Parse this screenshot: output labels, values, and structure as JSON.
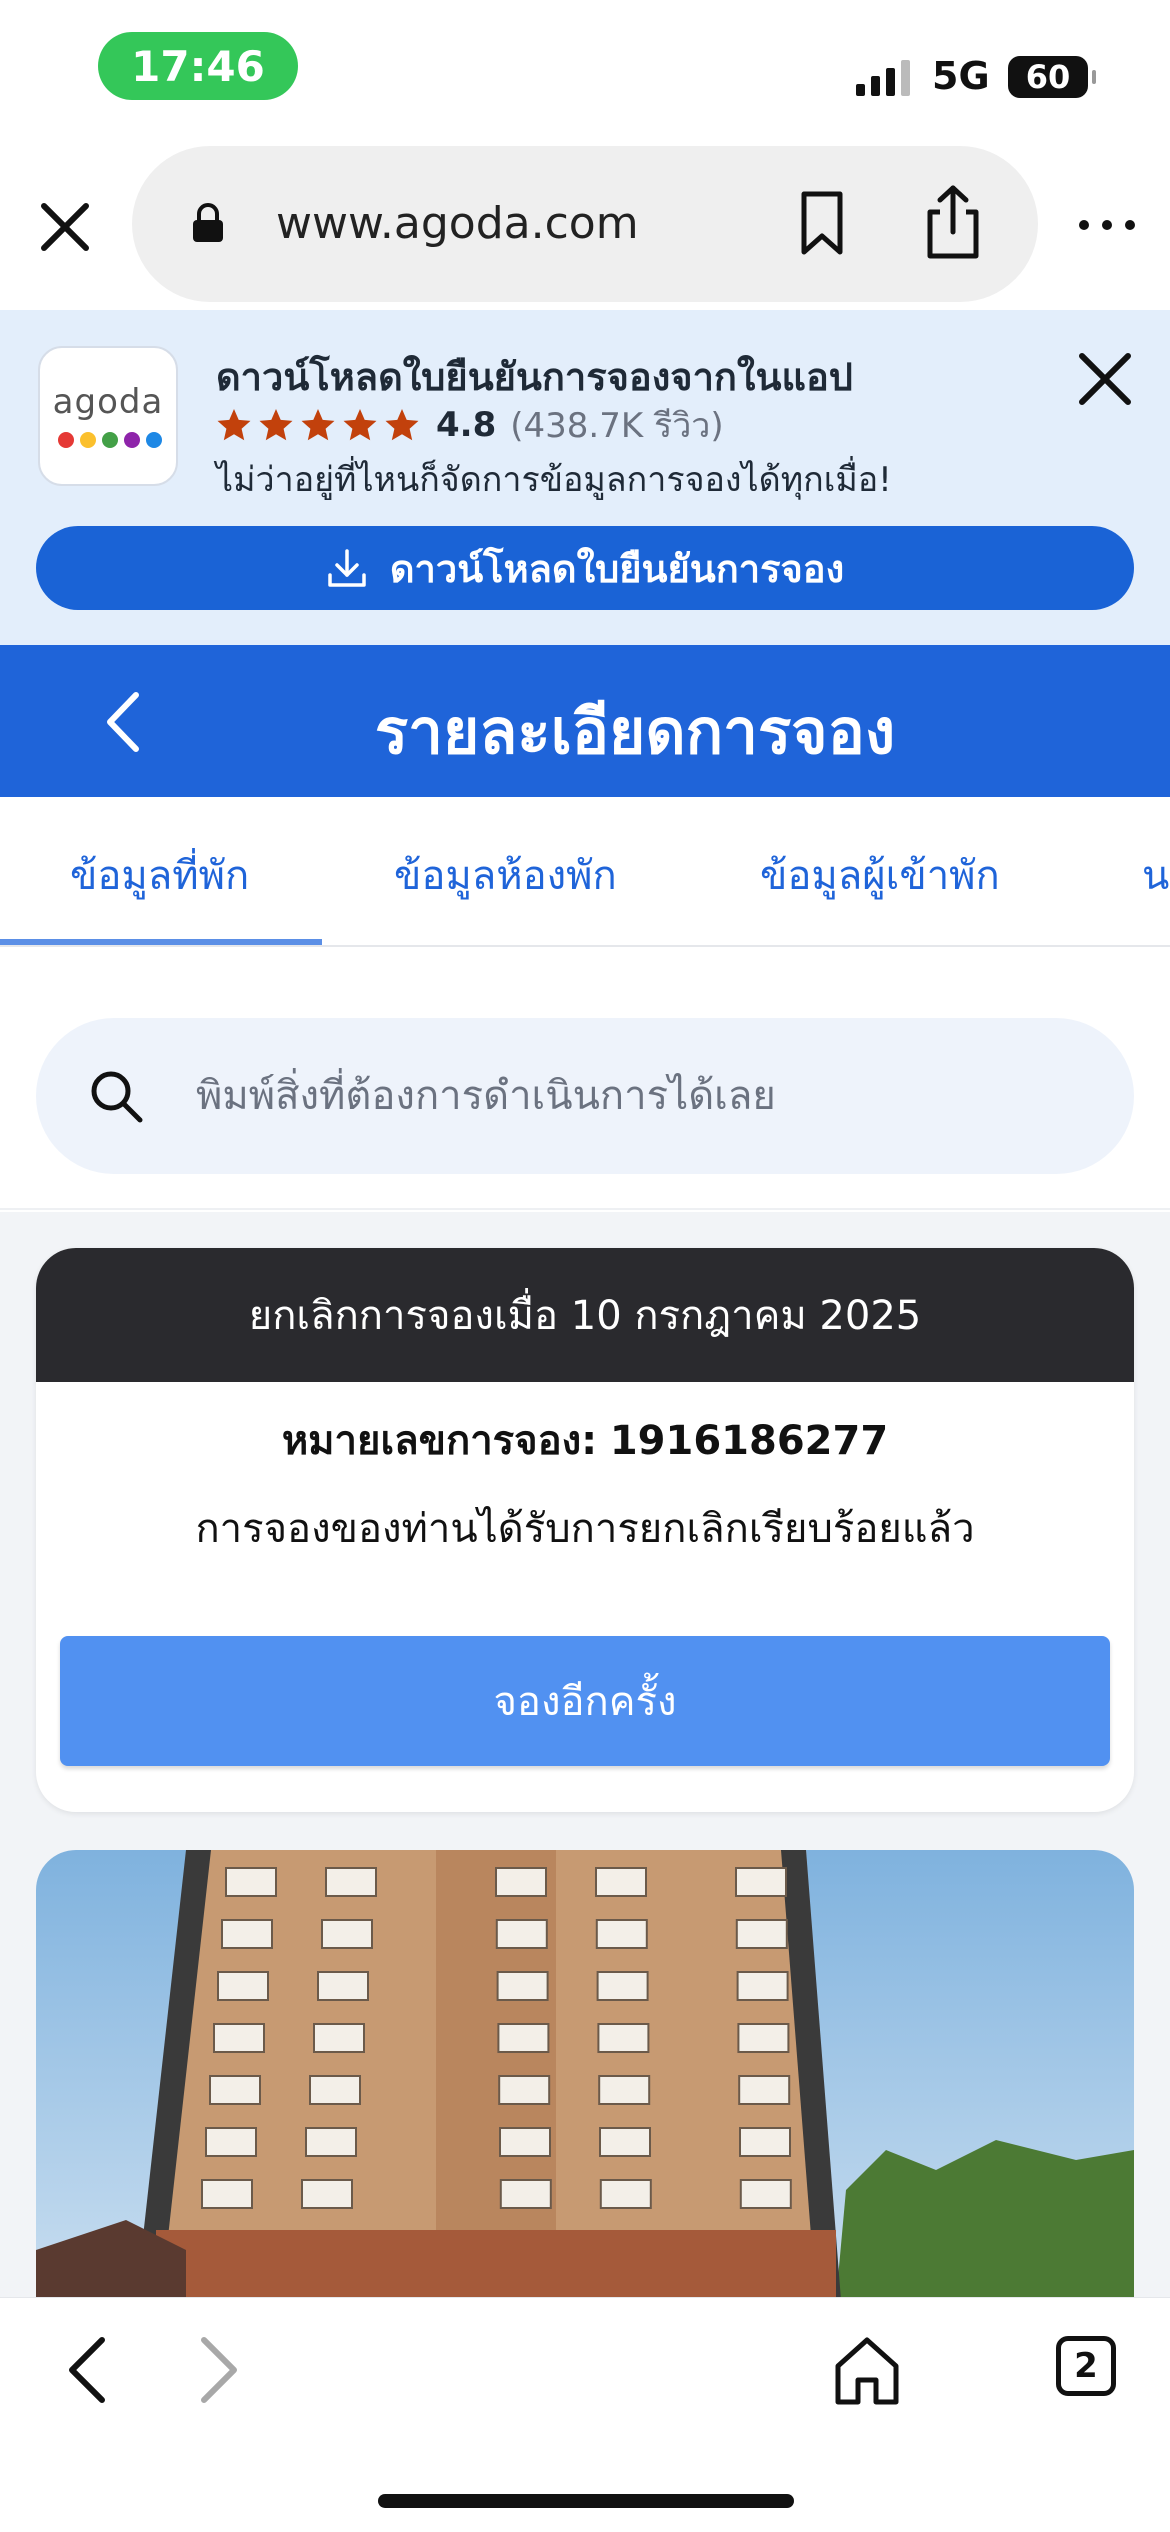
{
  "status_bar": {
    "time": "17:46",
    "network": "5G",
    "battery": "60"
  },
  "browser": {
    "url": "www.agoda.com",
    "icons": [
      "close-icon",
      "lock-icon",
      "bookmark-icon",
      "share-icon",
      "more-icon"
    ]
  },
  "app_banner": {
    "logo_text": "agoda",
    "logo_dot_colors": [
      "#e53935",
      "#fbc02d",
      "#43a047",
      "#8e24aa",
      "#1e88e5"
    ],
    "title": "ดาวน์โหลดใบยืนยันการจองจากในแอป",
    "rating_value": "4.8",
    "rating_count": "(438.7K รีวิว)",
    "stars": 5,
    "subtitle": "ไม่ว่าอยู่ที่ไหนก็จัดการข้อมูลการจองได้ทุกเมื่อ!",
    "download_label": "ดาวน์โหลดใบยืนยันการจอง",
    "star_color": "#c2410c"
  },
  "header": {
    "title": "รายละเอียดการจอง",
    "color": "#1f64d9"
  },
  "tabs": [
    {
      "label": "ข้อมูลที่พัก"
    },
    {
      "label": "ข้อมูลห้องพัก"
    },
    {
      "label": "ข้อมูลผู้เข้าพัก"
    },
    {
      "label": "น"
    }
  ],
  "search": {
    "placeholder": "พิมพ์สิ่งที่ต้องการดำเนินการได้เลย"
  },
  "cancel_card": {
    "header": "ยกเลิกการจองเมื่อ 10 กรกฎาคม 2025",
    "booking_label": "หมายเลขการจอง:",
    "booking_number": "1916186277",
    "message": "การจองของท่านได้รับการยกเลิกเรียบร้อยแล้ว",
    "rebook_label": "จองอีกครั้ง",
    "rebook_color": "#5191f1"
  },
  "bottom_bar": {
    "tab_count": "2",
    "icons": [
      "back-icon",
      "forward-icon",
      "home-icon",
      "tabs-icon"
    ]
  }
}
